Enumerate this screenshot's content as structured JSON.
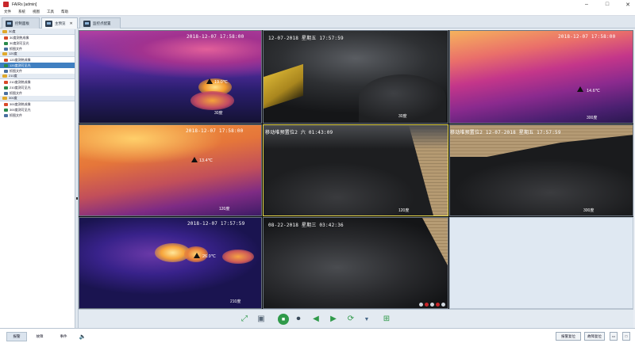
{
  "window": {
    "title": "FAIRs [admin]"
  },
  "menu": [
    "文件",
    "系统",
    "视图",
    "工具",
    "帮助"
  ],
  "tabs": [
    {
      "label": "控制面板",
      "active": false
    },
    {
      "label": "主预览",
      "active": true,
      "close": "✕"
    },
    {
      "label": "监控点配置",
      "active": false
    }
  ],
  "sidebar": {
    "groups": [
      {
        "name": "30度",
        "items": [
          {
            "label": "30度测热成像",
            "icon": "thermal-camera-icon"
          },
          {
            "label": "30度测可见光",
            "icon": "visible-camera-icon"
          },
          {
            "label": "抓图文件",
            "icon": "file-icon"
          }
        ]
      },
      {
        "name": "120度",
        "items": [
          {
            "label": "120度测热成像",
            "icon": "thermal-camera-icon"
          },
          {
            "label": "120度测可见光",
            "icon": "visible-camera-icon",
            "selected": true
          },
          {
            "label": "抓图文件",
            "icon": "file-icon"
          }
        ]
      },
      {
        "name": "210度",
        "items": [
          {
            "label": "210度测热成像",
            "icon": "thermal-camera-icon"
          },
          {
            "label": "210度测可见光",
            "icon": "visible-camera-icon"
          },
          {
            "label": "抓图文件",
            "icon": "file-icon"
          }
        ]
      },
      {
        "name": "300度",
        "items": [
          {
            "label": "300度测热成像",
            "icon": "thermal-camera-icon"
          },
          {
            "label": "300度测可见光",
            "icon": "visible-camera-icon"
          },
          {
            "label": "抓图文件",
            "icon": "file-icon"
          }
        ]
      }
    ]
  },
  "feeds": {
    "thermal_30": {
      "timestamp": "2018-12-07  17:58:00",
      "temp": "19.0℃",
      "angle": "30度"
    },
    "visible_30": {
      "timestamp": "12-07-2018  星期五  17:57:59",
      "angle": "30度"
    },
    "thermal_300": {
      "timestamp": "2018-12-07  17:58:00",
      "temp": "14.6℃",
      "angle": "300度"
    },
    "thermal_120": {
      "timestamp": "2018-12-07  17:58:00",
      "temp": "13.4℃",
      "angle": "120度"
    },
    "visible_120": {
      "timestamp": "移动堆预置位2    六  01:43:09",
      "angle": "120度"
    },
    "visible_300": {
      "timestamp": "移动堆预置位2   12-07-2018  星期五  17:57:59",
      "angle": "300度"
    },
    "thermal_210": {
      "timestamp": "2018-12-07  17:57:59",
      "temp": "26.9℃",
      "angle": "210度"
    },
    "visible_210": {
      "timestamp": "08-22-2018  星期三  03:42:36"
    }
  },
  "controls": {
    "icons": [
      "fullscreen-icon",
      "snapshot-icon",
      "stop-icon",
      "record-icon",
      "prev-icon",
      "next-icon",
      "refresh-icon",
      "dropdown-icon",
      "layout-icon"
    ]
  },
  "statusbar": {
    "tabs": [
      {
        "label": "报警",
        "active": true
      },
      {
        "label": "故障",
        "active": false
      },
      {
        "label": "事件",
        "active": false
      }
    ],
    "sound_icon": "speaker-icon",
    "buttons": [
      "报警复位",
      "故障复位"
    ],
    "window_icons": [
      "restore-icon",
      "maximize-icon"
    ]
  },
  "colors": {
    "accent": "#3f7fc1",
    "selected_border": "#e8d84a",
    "alarm": "#c8262a"
  }
}
